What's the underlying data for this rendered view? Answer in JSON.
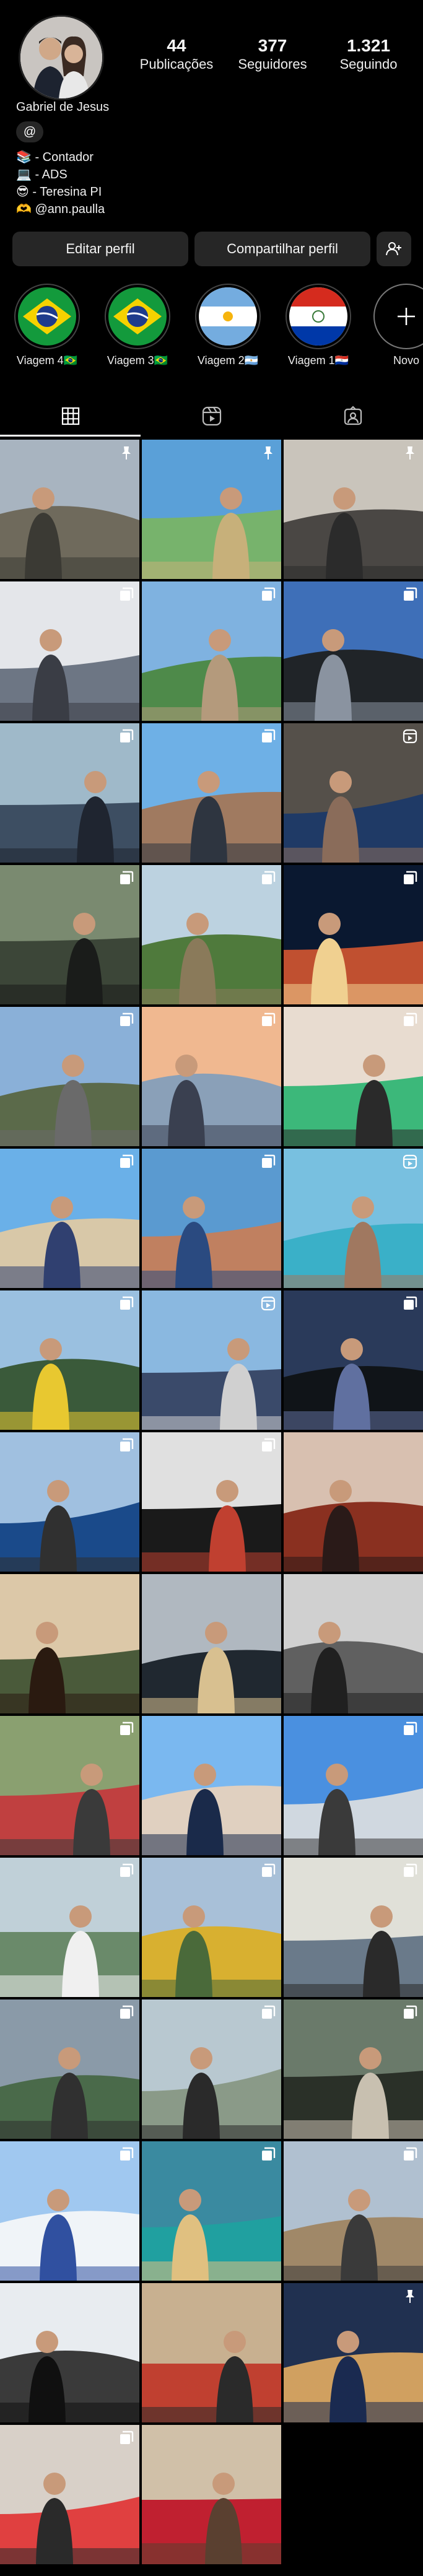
{
  "profile": {
    "name": "Gabriel de Jesus",
    "stats": {
      "posts": {
        "value": "44",
        "label": "Publicações"
      },
      "followers": {
        "value": "377",
        "label": "Seguidores"
      },
      "following": {
        "value": "1.321",
        "label": "Seguindo"
      }
    },
    "threads_icon": "@",
    "bio": [
      "📚 - Contador",
      "💻 - ADS",
      "😎 - Teresina PI",
      "🫶 @ann.paulla"
    ]
  },
  "buttons": {
    "edit": "Editar perfil",
    "share": "Compartilhar perfil",
    "add_person_icon": "person-add-icon"
  },
  "highlights": [
    {
      "label": "Viagem 4🇧🇷",
      "flag": "brazil"
    },
    {
      "label": "Viagem 3🇧🇷",
      "flag": "brazil"
    },
    {
      "label": "Viagem 2🇦🇷",
      "flag": "argentina"
    },
    {
      "label": "Viagem 1🇵🇾",
      "flag": "paraguay"
    },
    {
      "label": "Novo",
      "flag": "new"
    }
  ],
  "tabs": [
    "grid-icon",
    "reels-icon",
    "tagged-icon"
  ],
  "posts": [
    {
      "desc": "window-view",
      "badge": "pin",
      "c": [
        "#a8b4c0",
        "#6f6a5c",
        "#3b3a34"
      ]
    },
    {
      "desc": "beach-bus",
      "badge": "pin",
      "c": [
        "#5aa0d8",
        "#77b36c",
        "#c7b07a"
      ]
    },
    {
      "desc": "office-man",
      "badge": "pin",
      "c": [
        "#c9c4bb",
        "#4a4744",
        "#2b2b2b"
      ]
    },
    {
      "desc": "room-man",
      "badge": "multi",
      "c": [
        "#e4e6ea",
        "#6d7684",
        "#3a3d45"
      ]
    },
    {
      "desc": "couple-palms",
      "badge": "multi",
      "c": [
        "#7fb2e0",
        "#4e8a4a",
        "#b49a7c"
      ]
    },
    {
      "desc": "black-car",
      "badge": "multi",
      "c": [
        "#3e6fb8",
        "#202428",
        "#8a93a0"
      ]
    },
    {
      "desc": "selfie-cap",
      "badge": "multi",
      "c": [
        "#9fb9c9",
        "#3d4e62",
        "#1f2530"
      ]
    },
    {
      "desc": "couple-selfie",
      "badge": "multi",
      "c": [
        "#6eb0e6",
        "#a07a60",
        "#2e3540"
      ]
    },
    {
      "desc": "woman-shawl",
      "badge": "reel",
      "c": [
        "#55504a",
        "#1f3a66",
        "#8a6c5a"
      ]
    },
    {
      "desc": "driving",
      "badge": "multi",
      "c": [
        "#7a8a70",
        "#3c4638",
        "#1a1c1a"
      ]
    },
    {
      "desc": "garden",
      "badge": "multi",
      "c": [
        "#bcd2e0",
        "#4f7a3c",
        "#8a7a5a"
      ]
    },
    {
      "desc": "canela-night",
      "badge": "multi",
      "c": [
        "#0a1830",
        "#c05030",
        "#f0d090"
      ]
    },
    {
      "desc": "gate",
      "badge": "multi",
      "c": [
        "#8ab0d8",
        "#5b6a4a",
        "#6a6a6a"
      ]
    },
    {
      "desc": "sunset-couple",
      "badge": "multi",
      "c": [
        "#f0b890",
        "#8aa0b8",
        "#3a4050"
      ]
    },
    {
      "desc": "store-couple",
      "badge": "multi",
      "c": [
        "#e8dcd0",
        "#3cb87a",
        "#2a2a2a"
      ]
    },
    {
      "desc": "beach-swing",
      "badge": "multi",
      "c": [
        "#6ab0e8",
        "#d8c8a8",
        "#304070"
      ]
    },
    {
      "desc": "couple-sea",
      "badge": "multi",
      "c": [
        "#5a9ad0",
        "#c08060",
        "#2a4a80"
      ]
    },
    {
      "desc": "pool",
      "badge": "reel",
      "c": [
        "#78c0e0",
        "#3ab0c8",
        "#a07860"
      ]
    },
    {
      "desc": "ferrari-sign",
      "badge": "multi",
      "c": [
        "#9ac0e0",
        "#3a5a3a",
        "#e8c830"
      ]
    },
    {
      "desc": "race-track",
      "badge": "reel",
      "c": [
        "#8ab8e0",
        "#3a4a6a",
        "#d0d0d0"
      ]
    },
    {
      "desc": "dark-car",
      "badge": "multi",
      "c": [
        "#2a3a5a",
        "#101418",
        "#6070a0"
      ]
    },
    {
      "desc": "blue-car",
      "badge": "multi",
      "c": [
        "#a0c0e0",
        "#1a4a8a",
        "#303030"
      ]
    },
    {
      "desc": "man-white-car",
      "badge": "multi",
      "c": [
        "#e0e0e0",
        "#1a1a1a",
        "#c04030"
      ]
    },
    {
      "desc": "close-selfie",
      "badge": "none",
      "c": [
        "#d8c0b0",
        "#8a3020",
        "#2a1a18"
      ]
    },
    {
      "desc": "tree-shadow",
      "badge": "none",
      "c": [
        "#dcc8a8",
        "#4a5a3a",
        "#2a1a10"
      ]
    },
    {
      "desc": "silhouette",
      "badge": "none",
      "c": [
        "#b0b8c0",
        "#202830",
        "#d8c090"
      ]
    },
    {
      "desc": "bw-balcony",
      "badge": "none",
      "c": [
        "#d0d0d0",
        "#606060",
        "#202020"
      ]
    },
    {
      "desc": "group-photo",
      "badge": "multi",
      "c": [
        "#8aa070",
        "#c04040",
        "#3a3a3a"
      ]
    },
    {
      "desc": "selfie-sky",
      "badge": "none",
      "c": [
        "#7ab8f0",
        "#e0d0c0",
        "#1a2a4a"
      ]
    },
    {
      "desc": "motorcycle",
      "badge": "multi",
      "c": [
        "#4a90e0",
        "#d0d8e0",
        "#3a3a3a"
      ]
    },
    {
      "desc": "waterfall-man",
      "badge": "multi",
      "c": [
        "#c0d0d8",
        "#6a8a6a",
        "#f0f0f0"
      ]
    },
    {
      "desc": "transformer",
      "badge": "multi",
      "c": [
        "#a8c0d8",
        "#d8b030",
        "#4a6a3a"
      ]
    },
    {
      "desc": "mall-man",
      "badge": "multi",
      "c": [
        "#e0e0d8",
        "#6a7a8a",
        "#2a2a2a"
      ]
    },
    {
      "desc": "lake-man",
      "badge": "multi",
      "c": [
        "#8a9aa8",
        "#4a6a4a",
        "#303030"
      ]
    },
    {
      "desc": "waterfall-couple",
      "badge": "multi",
      "c": [
        "#b8c8d0",
        "#8a9a88",
        "#2a2a2a"
      ]
    },
    {
      "desc": "car-interior",
      "badge": "multi",
      "c": [
        "#6a7a6a",
        "#2a3028",
        "#c8c0b0"
      ]
    },
    {
      "desc": "snowman",
      "badge": "multi",
      "c": [
        "#a0c8f0",
        "#f0f4f8",
        "#3050a0"
      ]
    },
    {
      "desc": "aquarium",
      "badge": "multi",
      "c": [
        "#3a8aa0",
        "#20a0a0",
        "#e0c080"
      ]
    },
    {
      "desc": "church-square",
      "badge": "multi",
      "c": [
        "#b0c0d0",
        "#a08868",
        "#3a3a3a"
      ]
    },
    {
      "desc": "plane-window",
      "badge": "none",
      "c": [
        "#e8ecf0",
        "#3a3a3a",
        "#101010"
      ]
    },
    {
      "desc": "restaurant",
      "badge": "none",
      "c": [
        "#c8b090",
        "#c04030",
        "#2a2a2a"
      ]
    },
    {
      "desc": "night-street",
      "badge": "pin",
      "c": [
        "#203050",
        "#d0a060",
        "#1a2a50"
      ]
    },
    {
      "desc": "archery",
      "badge": "multi",
      "c": [
        "#d8d0c8",
        "#e04040",
        "#2a2a2a"
      ]
    },
    {
      "desc": "boy-playing",
      "badge": "none",
      "c": [
        "#d0c0a8",
        "#c02030",
        "#5a4030"
      ]
    }
  ]
}
